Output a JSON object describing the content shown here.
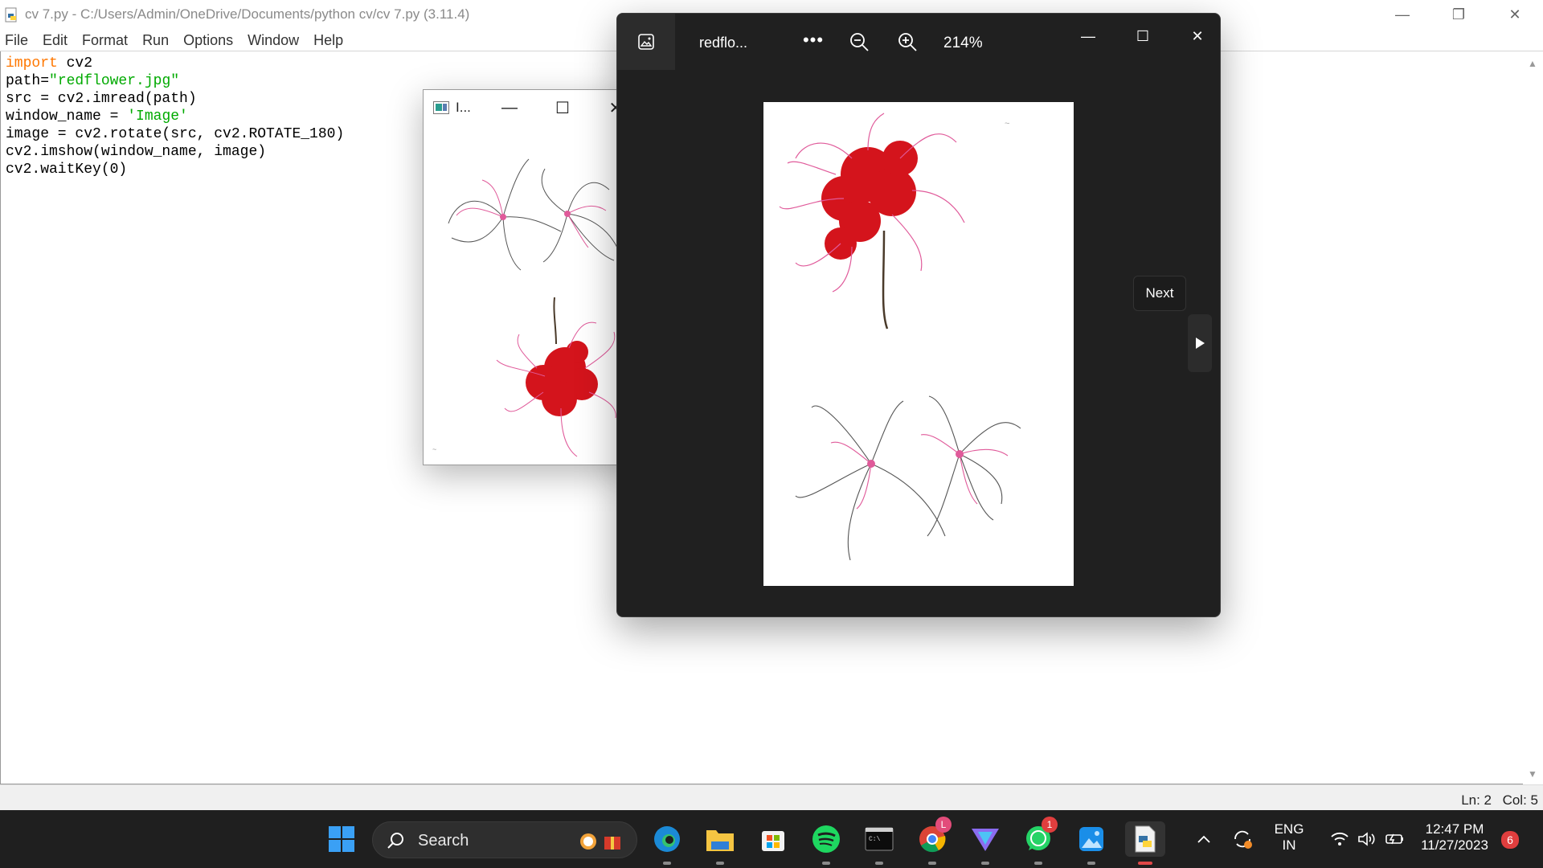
{
  "idle": {
    "title": "cv 7.py - C:/Users/Admin/OneDrive/Documents/python cv/cv 7.py (3.11.4)",
    "menu": [
      "File",
      "Edit",
      "Format",
      "Run",
      "Options",
      "Window",
      "Help"
    ],
    "code": [
      {
        "kw": "import",
        "rest": " cv2"
      },
      {
        "pre": "path=",
        "str": "\"redflower.jpg\""
      },
      {
        "plain": "src = cv2.imread(path)"
      },
      {
        "pre": "window_name = ",
        "str": "'Image'"
      },
      {
        "plain": "image = cv2.rotate(src, cv2.ROTATE_180)"
      },
      {
        "plain": "cv2.imshow(window_name, image)"
      },
      {
        "plain": "cv2.waitKey(0)"
      }
    ],
    "status": {
      "ln": "Ln: 2",
      "col": "Col: 5"
    }
  },
  "cv_window": {
    "title": "I..."
  },
  "photos": {
    "title": "redflo...",
    "more": "•••",
    "zoom": "214%",
    "next_label": "Next"
  },
  "taskbar": {
    "search_label": "Search",
    "lang_top": "ENG",
    "lang_bottom": "IN",
    "time": "12:47 PM",
    "date": "11/27/2023",
    "notification_count": "6",
    "chrome_profile": "L",
    "whatsapp_badge": "1"
  },
  "colors": {
    "keyword": "#ff7700",
    "string": "#00aa00",
    "taskbar_bg": "#1f1f1f",
    "photos_bg": "#202020",
    "flower_red": "#d4141c",
    "flower_pink": "#e05a9a"
  }
}
